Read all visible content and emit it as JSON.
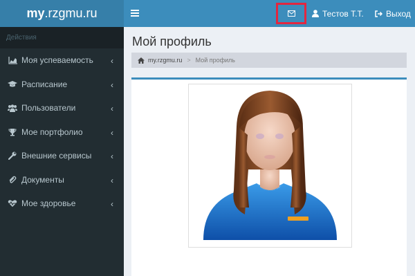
{
  "header": {
    "logo_bold": "my",
    "logo_rest": ".rzgmu.ru",
    "user_name": "Тестов Т.Т.",
    "logout_label": "Выход"
  },
  "sidebar": {
    "section_label": "Действия",
    "items": [
      {
        "label": "Моя успеваемость",
        "icon": "area-chart-icon"
      },
      {
        "label": "Расписание",
        "icon": "graduation-cap-icon"
      },
      {
        "label": "Пользователи",
        "icon": "users-icon"
      },
      {
        "label": "Мое портфолио",
        "icon": "trophy-icon"
      },
      {
        "label": "Внешние сервисы",
        "icon": "wrench-icon"
      },
      {
        "label": "Документы",
        "icon": "paperclip-icon"
      },
      {
        "label": "Мое здоровье",
        "icon": "heartbeat-icon"
      }
    ]
  },
  "content": {
    "title": "Мой профиль",
    "breadcrumb": {
      "home": "my.rzgmu.ru",
      "current": "Мой профиль"
    }
  },
  "colors": {
    "header": "#3c8dbc",
    "logo_bg": "#367fa9",
    "sidebar": "#222d32",
    "highlight": "#e3263f"
  }
}
